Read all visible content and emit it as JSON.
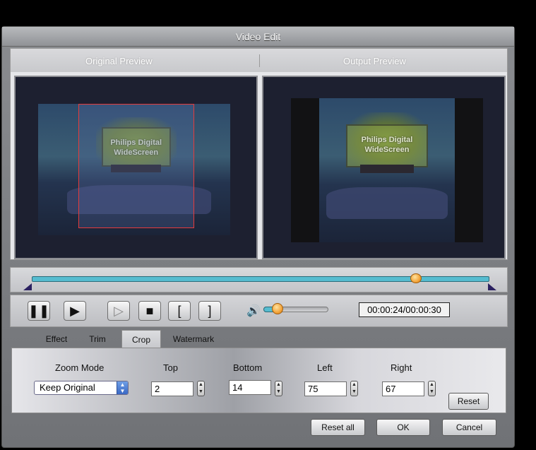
{
  "window": {
    "title": "Video Edit"
  },
  "preview": {
    "original_label": "Original Preview",
    "output_label": "Output Preview",
    "tv_text_line1": "Philips Digital",
    "tv_text_line2": "WideScreen"
  },
  "timeline": {
    "position": 0.84
  },
  "controls": {
    "pause_icon": "pause-icon",
    "step_play_icon": "step-play-icon",
    "next_frame_icon": "next-frame-icon",
    "stop_icon": "stop-icon",
    "mark_in_icon": "mark-in-icon",
    "mark_out_icon": "mark-out-icon",
    "volume_icon": "speaker-icon",
    "volume_level": 0.15,
    "time": "00:00:24/00:00:30"
  },
  "tabs": [
    {
      "label": "Effect"
    },
    {
      "label": "Trim"
    },
    {
      "label": "Crop"
    },
    {
      "label": "Watermark"
    }
  ],
  "active_tab": "Crop",
  "crop": {
    "zoom_mode_label": "Zoom Mode",
    "zoom_mode_value": "Keep Original",
    "top_label": "Top",
    "top_value": "2",
    "bottom_label": "Bottom",
    "bottom_value": "14",
    "left_label": "Left",
    "left_value": "75",
    "right_label": "Right",
    "right_value": "67",
    "reset_label": "Reset"
  },
  "footer": {
    "reset_all_label": "Reset all",
    "ok_label": "OK",
    "cancel_label": "Cancel"
  },
  "colors": {
    "accent": "#56bcd0",
    "crop_rect": "#e43b3b",
    "knob": "#f2a43b"
  }
}
